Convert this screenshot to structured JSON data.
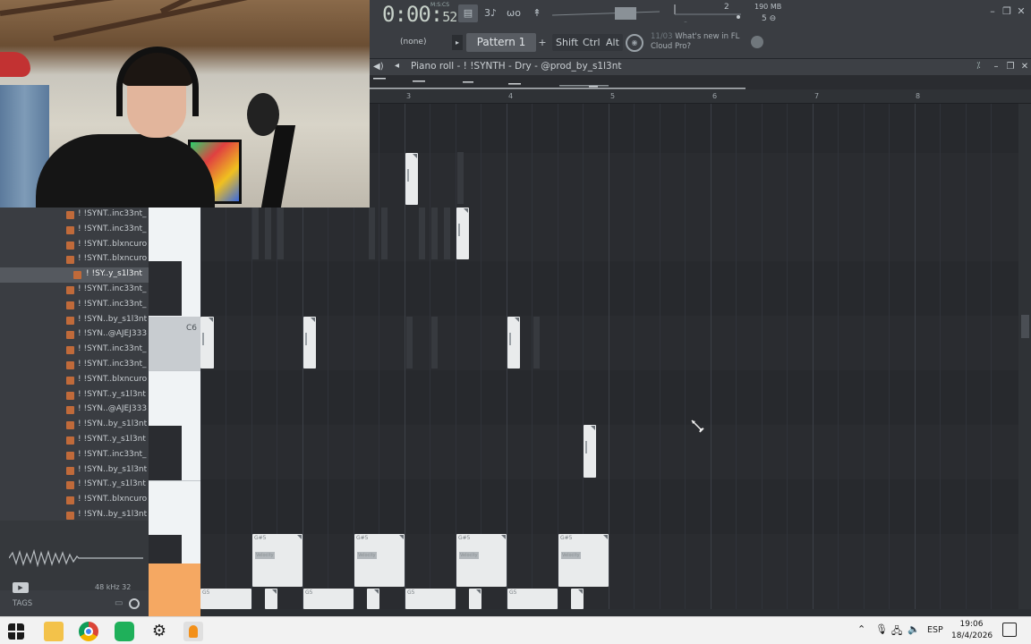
{
  "toolbar": {
    "time_main": "0:00",
    "time_sec": "52",
    "time_label": "M:S:CS",
    "cpu_value": "2",
    "memory": "190 MB",
    "polyphony": "5"
  },
  "row2": {
    "snap": "(none)",
    "pattern": "Pattern 1",
    "shift": "Shift",
    "ctrl": "Ctrl",
    "alt": "Alt",
    "news_count": "11/03",
    "news_text": "What's new in FL Cloud Pro?"
  },
  "piano_roll": {
    "title": "Piano roll - ! !SYNTH - Dry - @prod_by_s1l3nt",
    "ruler": [
      "3",
      "4",
      "5",
      "6",
      "7",
      "8"
    ],
    "key_label": "C6",
    "note_labels": {
      "gs5": "G#5",
      "g5": "G5",
      "velocity": "Velocity"
    }
  },
  "browser": {
    "items": [
      "! !SYNT..inc33nt_",
      "! !SYNT..inc33nt_",
      "! !SYNT..blxncuro",
      "! !SYNT..blxncuro",
      "! !SY..y_s1l3nt",
      "! !SYNT..inc33nt_",
      "! !SYNT..inc33nt_",
      "! !SYN..by_s1l3nt",
      "! !SYN..@AJEJ333",
      "! !SYNT..inc33nt_",
      "! !SYNT..inc33nt_",
      "! !SYNT..blxncuro",
      "! !SYNT..y_s1l3nt",
      "! !SYN..@AJEJ333",
      "! !SYN..by_s1l3nt",
      "! !SYNT..y_s1l3nt",
      "! !SYNT..inc33nt_",
      "! !SYN..by_s1l3nt",
      "! !SYNT..y_s1l3nt",
      "! !SYNT..blxncuro",
      "! !SYN..by_s1l3nt"
    ],
    "selected_index": 4,
    "sample_rate": "48 kHz 32",
    "tags_label": "TAGS"
  },
  "taskbar": {
    "lang": "ESP",
    "time": "19:06",
    "date": "18/4/2026"
  },
  "colors": {
    "accent_orange": "#f5a862",
    "note_fill": "#e9ebec",
    "grid_bg": "#2a2c30",
    "browser_icon": "#c06a3a"
  }
}
